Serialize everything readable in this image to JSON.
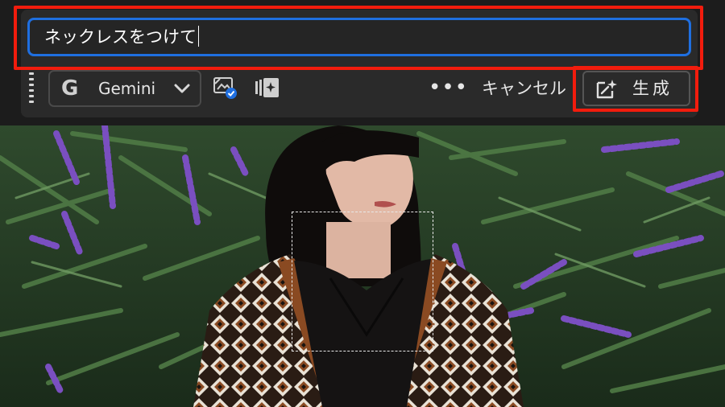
{
  "prompt": {
    "value": "ネックレスをつけて"
  },
  "toolbar": {
    "model": {
      "icon": "google-g-icon",
      "glyph": "G",
      "label": "Gemini"
    },
    "more_label": "•••",
    "cancel_label": "キャンセル",
    "generate_label": "生成"
  },
  "colors": {
    "highlight": "#f21c0d",
    "input_focus": "#1f6fe0",
    "panel": "#2a2a2a"
  },
  "photo": {
    "description_icon": "portrait-photo",
    "selection": "active-marquee"
  }
}
